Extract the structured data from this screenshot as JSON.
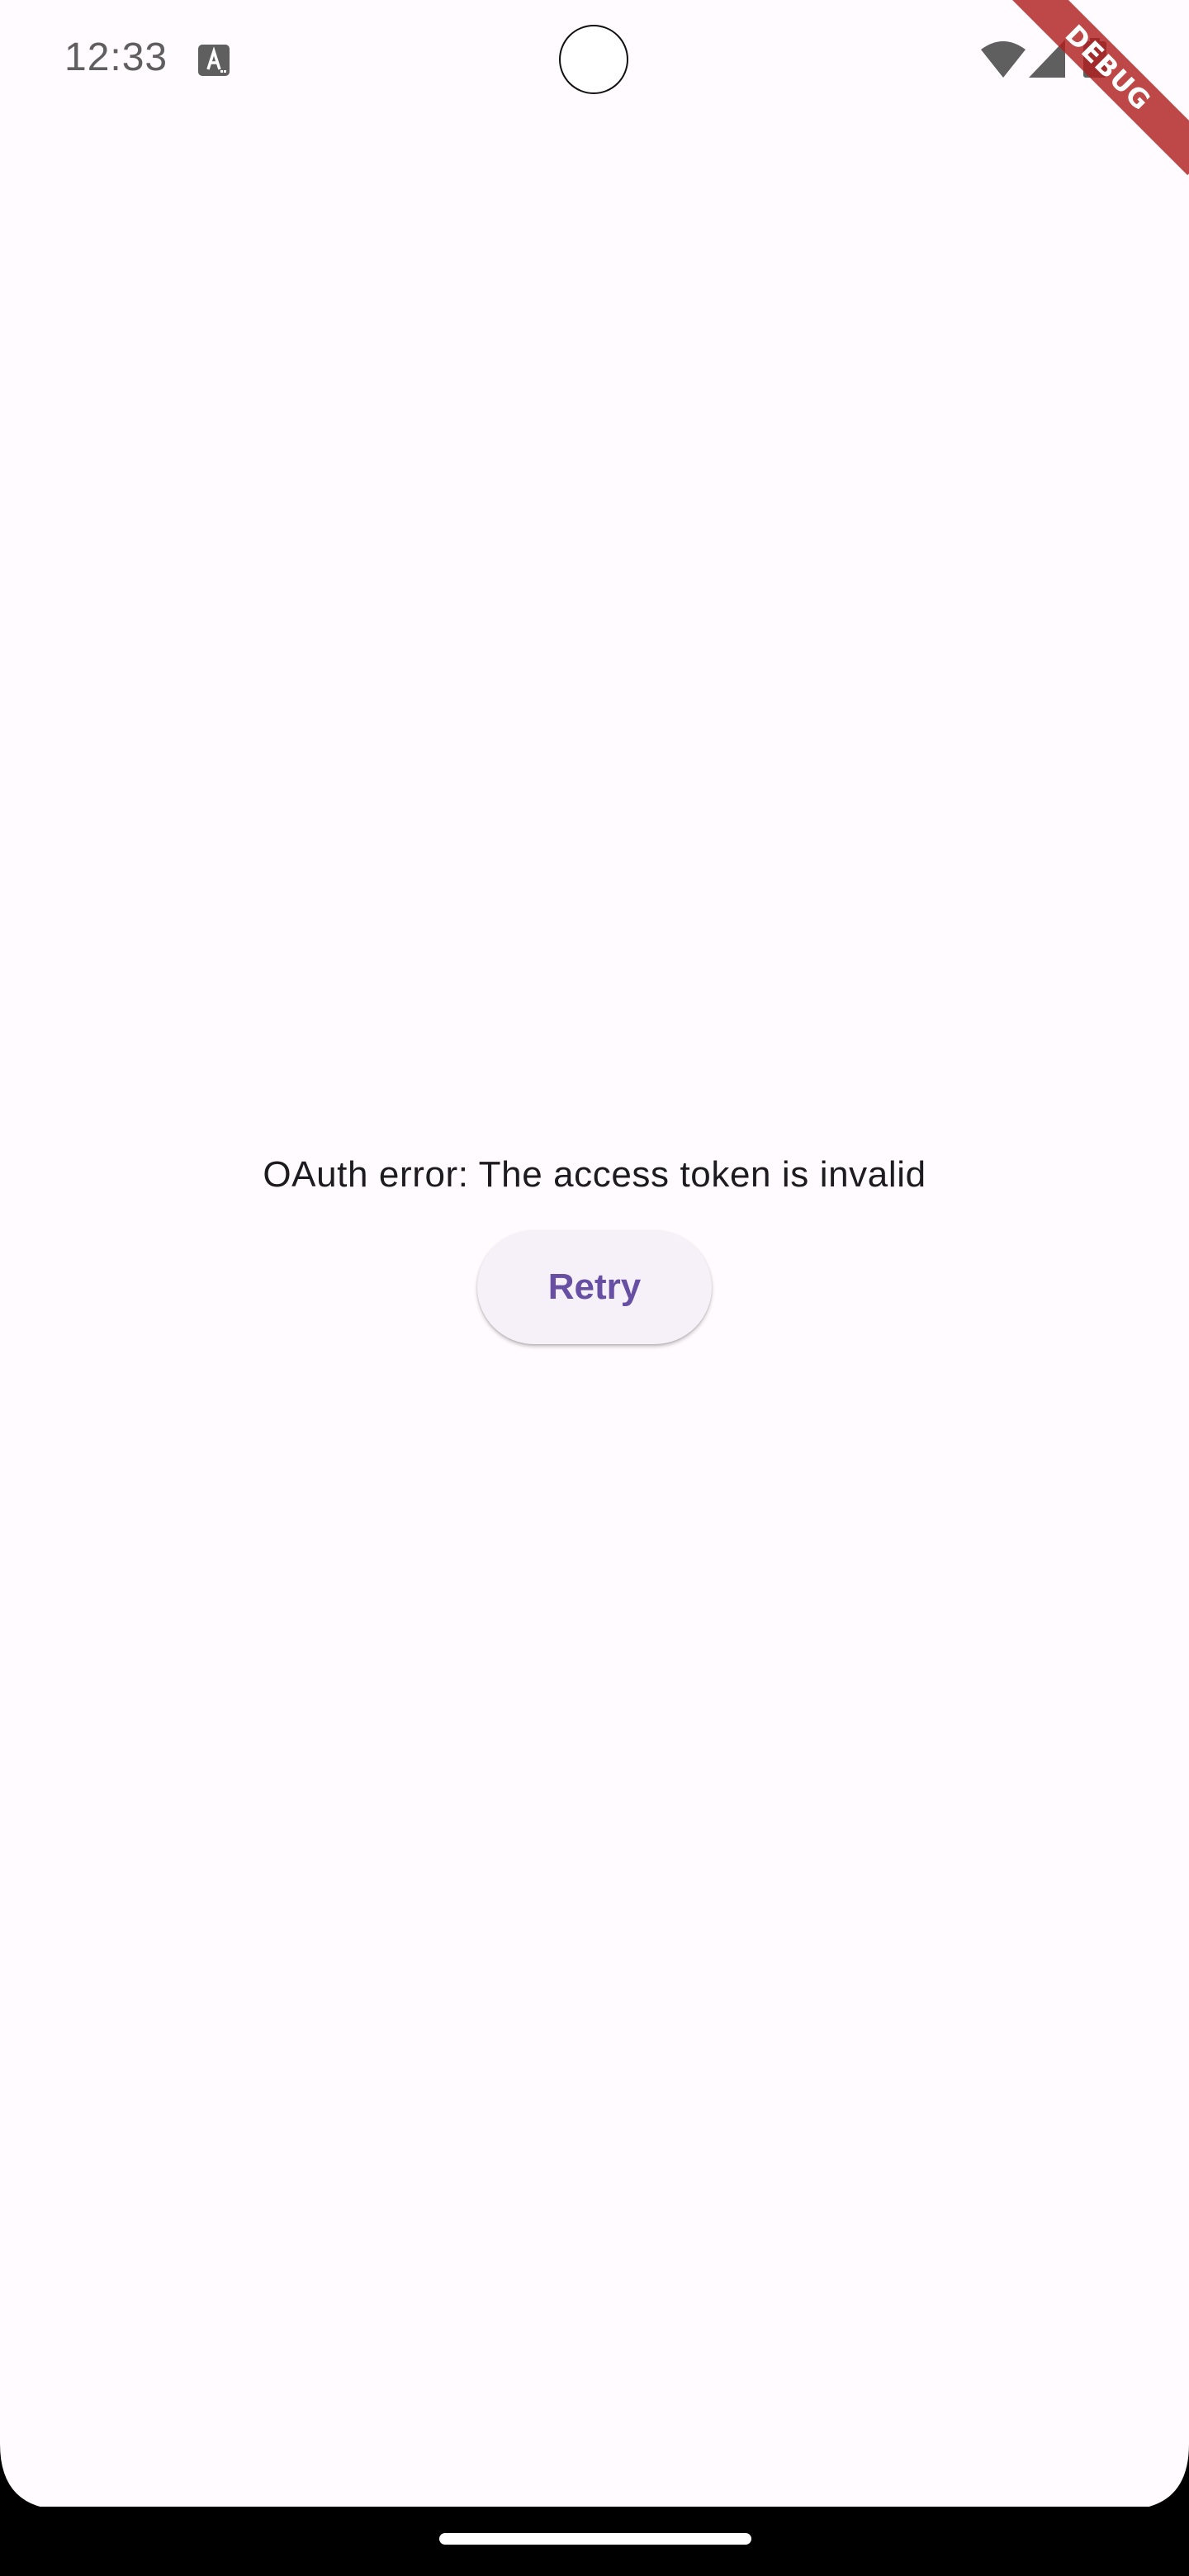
{
  "status_bar": {
    "time": "12:33",
    "icons": [
      "text-a-icon",
      "wifi-icon",
      "signal-icon",
      "battery-icon"
    ]
  },
  "debug_banner": {
    "label": "DEBUG",
    "color": "#b02020"
  },
  "main": {
    "error_message": "OAuth error: The access token is invalid",
    "retry_label": "Retry"
  },
  "colors": {
    "background": "#fffbfe",
    "accent": "#6750a4",
    "button_bg": "#f6f1f8",
    "text": "#1c1b1f"
  }
}
